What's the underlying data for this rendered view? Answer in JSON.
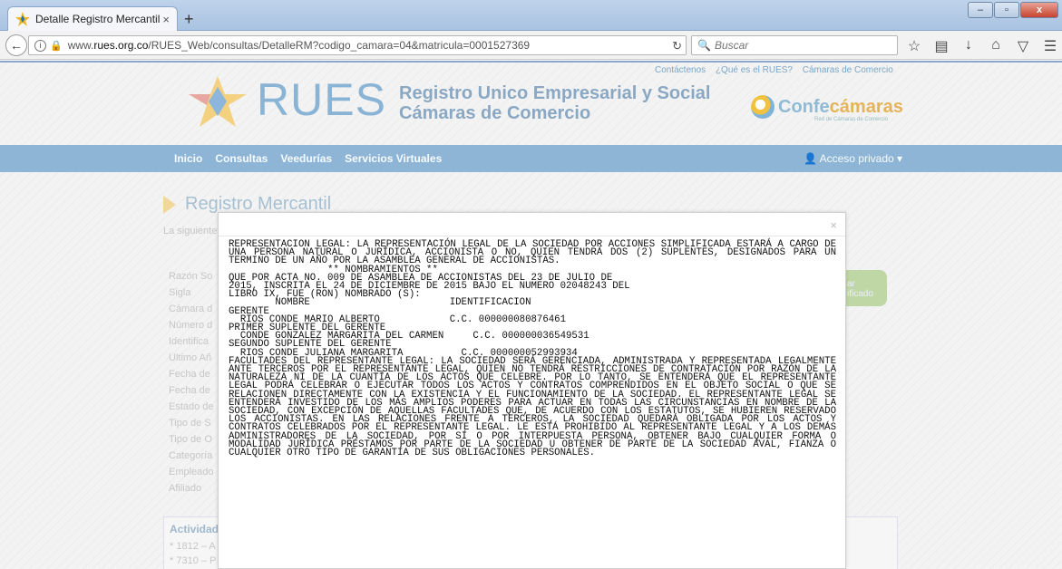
{
  "browser": {
    "tab_title": "Detalle Registro Mercantil",
    "tab_close": "×",
    "new_tab": "+",
    "url_prefix": "www.",
    "url_host": "rues.org.co",
    "url_path": "/RUES_Web/consultas/DetalleRM?codigo_camara=04&matricula=0001527369",
    "search_placeholder": "Buscar",
    "win_min": "–",
    "win_max": "▫",
    "win_close": "x"
  },
  "header": {
    "toplinks": [
      "Contáctenos",
      "¿Qué es el RUES?",
      "Cámaras de Comercio"
    ],
    "logo": "RUES",
    "subtitle_1": "Registro Unico Empresarial y Social",
    "subtitle_2": "Cámaras de Comercio",
    "confe_prefix": "Confe",
    "confe_highlight": "cámaras",
    "confe_sub": "Red de Cámaras de Comercio"
  },
  "nav": {
    "items": [
      "Inicio",
      "Consultas",
      "Veedurías",
      "Servicios Virtuales"
    ],
    "acceso": "Acceso privado"
  },
  "main": {
    "title": "Registro Mercantil",
    "intro": "La siguiente",
    "labels": [
      "Razón So",
      "Sigla",
      "Cámara d",
      "Número d",
      "Identifica",
      "Último Añ",
      "Fecha de",
      "Fecha de",
      "Estado de",
      "Tipo de S",
      "Tipo de O",
      "Categoría",
      "Empleado",
      "Afiliado"
    ],
    "green_button": "ar\nificado",
    "actividad_title": "Actividad",
    "actividad_items": [
      "* 1812 – A",
      "* 7310 – P"
    ]
  },
  "modal": {
    "close": "×",
    "text": "REPRESENTACION LEGAL: LA REPRESENTACIÓN LEGAL DE LA SOCIEDAD POR ACCIONES SIMPLIFICADA ESTARÁ A CARGO DE UNA PERSONA NATURAL O JURÍDICA, ACCIONISTA O NO, QUIEN TENDRÁ DOS (2) SUPLENTES, DESIGNADOS PARA UN TERMINO DE UN AÑO POR LA ASAMBLEA GENERAL DE ACCIONISTAS.\n                 ** NOMBRAMIENTOS **\nQUE POR ACTA NO. 009 DE ASAMBLEA DE ACCIONISTAS DEL 23 DE JULIO DE\n2015, INSCRITA EL 24 DE DICIEMBRE DE 2015 BAJO EL NUMERO 02048243 DEL\nLIBRO IX, FUE (RON) NOMBRADO (S):\n        NOMBRE                        IDENTIFICACION\nGERENTE\n  RIOS CONDE MARIO ALBERTO            C.C. 000000080876461\nPRIMER SUPLENTE DEL GERENTE\n  CONDE GONZALEZ MARGARITA DEL CARMEN     C.C. 000000036549531\nSEGUNDO SUPLENTE DEL GERENTE\n  RIOS CONDE JULIANA MARGARITA          C.C. 000000052993934\nFACULTADES DEL REPRESENTANTE LEGAL: LA SOCIEDAD SERÁ GERENCIADA, ADMINISTRADA Y REPRESENTADA LEGALMENTE ANTE TERCEROS POR EL REPRESENTANTE LEGAL, QUIEN NO TENDRÁ RESTRICCIONES DE CONTRATACIÓN POR RAZÓN DE LA NATURALEZA NI DE LA CUANTÍA DE LOS ACTOS QUE CELEBRE. POR LO TANTO, SE ENTENDERÁ QUE EL REPRESENTANTE LEGAL PODRÁ CELEBRAR O EJECUTAR TODOS LOS ACTOS Y CONTRATOS COMPRENDIDOS EN EL OBJETO SOCIAL O QUE SE RELACIONEN DIRECTAMENTE CON LA EXISTENCIA Y EL FUNCIONAMIENTO DE LA SOCIEDAD. EL REPRESENTANTE LEGAL SE ENTENDERÁ INVESTIDO DE LOS MÁS AMPLIOS PODERES PARA ACTUAR EN TODAS LAS CIRCUNSTANCIAS EN NOMBRE DE LA SOCIEDAD, CON EXCEPCIÓN DE AQUELLAS FACULTADES QUE, DE ACUERDO CON LOS ESTATUTOS, SE HUBIEREN RESERVADO LOS ACCIONISTAS. EN LAS RELACIONES FRENTE A TERCEROS, LA SOCIEDAD QUEDARÁ OBLIGADA POR LOS ACTOS Y CONTRATOS CELEBRADOS POR EL REPRESENTANTE LEGAL. LE ESTÁ PROHIBIDO AL REPRESENTANTE LEGAL Y A LOS DEMÁS ADMINISTRADORES DE LA SOCIEDAD, POR SÍ O POR INTERPUESTA PERSONA, OBTENER BAJO CUALQUIER FORMA O MODALIDAD JURÍDICA PRÉSTAMOS POR PARTE DE LA SOCIEDAD U OBTENER DE PARTE DE LA SOCIEDAD AVAL, FIANZA O CUALQUIER OTRO TIPO DE GARANTÍA DE SUS OBLIGACIONES PERSONALES."
  }
}
